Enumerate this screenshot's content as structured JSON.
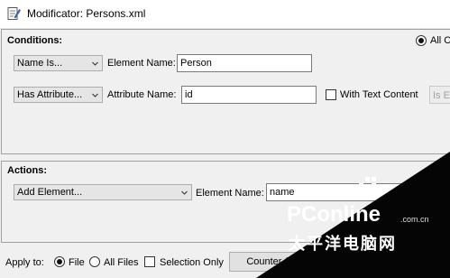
{
  "window": {
    "title": "Modificator: Persons.xml"
  },
  "conditions": {
    "label": "Conditions:",
    "radio_all_label": "All C",
    "row1": {
      "combo": "Name Is...",
      "field_label": "Element Name:",
      "field_value": "Person"
    },
    "row2": {
      "combo": "Has Attribute...",
      "field_label": "Attribute Name:",
      "field_value": "id",
      "with_text_label": "With Text Content",
      "is_button": "Is E"
    }
  },
  "actions": {
    "label": "Actions:",
    "row1": {
      "combo": "Add Element...",
      "field_label": "Element Name:",
      "field_value": "name"
    }
  },
  "footer": {
    "apply_to": "Apply to:",
    "file": "File",
    "all_files": "All Files",
    "selection_only": "Selection Only",
    "counter_button": "Counter (s"
  },
  "watermark": {
    "brand": "PConline",
    "domain": ".com.cn",
    "cn_text": "太平洋电脑网"
  }
}
